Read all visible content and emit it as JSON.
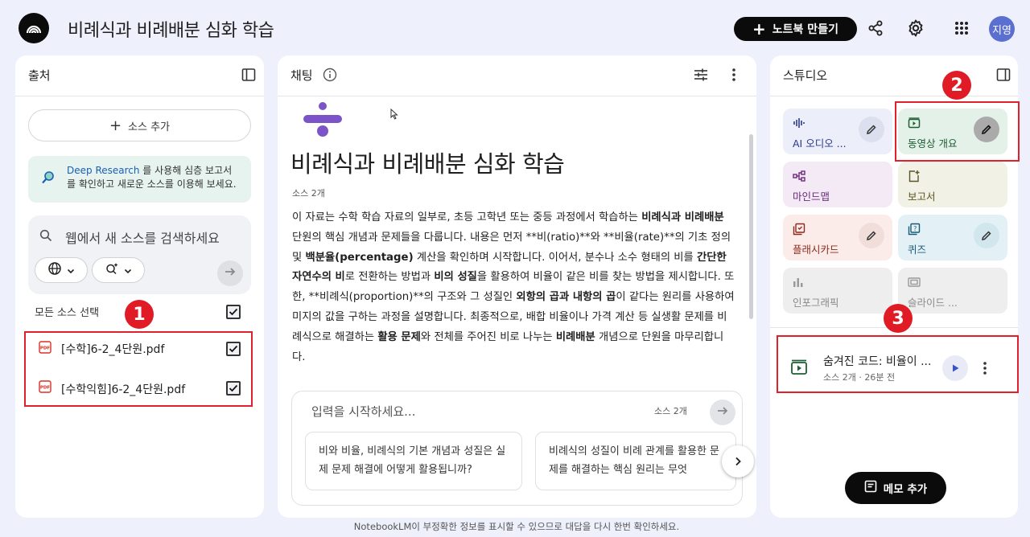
{
  "header": {
    "title": "비례식과 비례배분 심화 학습",
    "new_notebook_label": "노트북 만들기",
    "avatar_text": "지영",
    "icons": [
      "notebooklm-logo-icon",
      "share-icon",
      "gear-icon",
      "apps-grid-icon"
    ]
  },
  "sources_panel": {
    "title": "출처",
    "add_source_label": "소스 추가",
    "deep_research": {
      "link": "Deep Research",
      "text_1": " 를 사용해 심층 보고서",
      "text_2": "를 확인하고 새로운 소스를 이용해 보세요."
    },
    "web_search_placeholder": "웹에서 새 소스를 검색하세요",
    "select_all_label": "모든 소스 선택",
    "items": [
      {
        "name": "[수학]6-2_4단원.pdf",
        "checked": true
      },
      {
        "name": "[수학익힘]6-2_4단원.pdf",
        "checked": true
      }
    ]
  },
  "chat_panel": {
    "title": "채팅",
    "notebook_title": "비례식과 비례배분 심화 학습",
    "source_count": "소스 2개",
    "summary_parts": [
      {
        "t": "이 자료는 수학 학습 자료의 일부로, 초등 고학년 또는 중등 과정에서 학습하는 ",
        "b": false
      },
      {
        "t": "비례식과 비례배분",
        "b": true
      },
      {
        "t": " 단원의 핵심 개념과 문제들을 다룹니다. 내용은 먼저 **비(ratio)**와 **비율(rate)**의 기초 정의 및 ",
        "b": false
      },
      {
        "t": "백분율(percentage)",
        "b": true
      },
      {
        "t": " 계산을 확인하며 시작합니다. 이어서, 분수나 소수 형태의 비를 ",
        "b": false
      },
      {
        "t": "간단한 자연수의 비",
        "b": true
      },
      {
        "t": "로 전환하는 방법과 ",
        "b": false
      },
      {
        "t": "비의 성질",
        "b": true
      },
      {
        "t": "을 활용하여 비율이 같은 비를 찾는 방법을 제시합니다. 또한, **비례식(proportion)**의 구조와 그 성질인 ",
        "b": false
      },
      {
        "t": "외항의 곱과 내항의 곱",
        "b": true
      },
      {
        "t": "이 같다는 원리를 사용하여 미지의 값을 구하는 과정을 설명합니다. 최종적으로, 배합 비율이나 가격 계산 등 실생활 문제를 비례식으로 해결하는 ",
        "b": false
      },
      {
        "t": "활용 문제",
        "b": true
      },
      {
        "t": "와 전체를 주어진 비로 나누는 ",
        "b": false
      },
      {
        "t": "비례배분",
        "b": true
      },
      {
        "t": " 개념으로 단원을 마무리합니다.",
        "b": false
      }
    ],
    "input_placeholder": "입력을 시작하세요...",
    "input_source_count": "소스 2개",
    "suggestions": [
      "비와 비율, 비례식의 기본 개념과 성질은 실제 문제 해결에 어떻게 활용됩니까?",
      "비례식의 성질이 비례 관계를 활용한 문제를 해결하는 핵심 원리는 무엇"
    ]
  },
  "studio_panel": {
    "title": "스튜디오",
    "tiles": [
      {
        "label": "AI 오디오 ...",
        "icon": "audio-wave-icon",
        "color": "#eceef9",
        "text_color": "#2b3a8f"
      },
      {
        "label": "동영상 개요",
        "icon": "video-icon",
        "color": "#e3f1e8",
        "text_color": "#1d5e34"
      },
      {
        "label": "마인드맵",
        "icon": "mindmap-icon",
        "color": "#f3eaf5",
        "text_color": "#6b2a7c"
      },
      {
        "label": "보고서",
        "icon": "report-icon",
        "color": "#f2f1e6",
        "text_color": "#5b5420"
      },
      {
        "label": "플래시카드",
        "icon": "flashcard-icon",
        "color": "#fbecea",
        "text_color": "#8a2a1e"
      },
      {
        "label": "퀴즈",
        "icon": "quiz-icon",
        "color": "#e3f1f7",
        "text_color": "#1a5a74"
      },
      {
        "label": "인포그래픽",
        "icon": "infographic-icon",
        "color": "#eeeeee",
        "text_color": "#8a8a8a"
      },
      {
        "label": "슬라이드 ...",
        "icon": "slides-icon",
        "color": "#eeeeee",
        "text_color": "#8a8a8a"
      }
    ],
    "generated_item": {
      "title": "숨겨진 코드: 비율이 ...",
      "meta": "소스 2개 · 26분 전"
    },
    "add_memo_label": "메모 추가"
  },
  "annotations": {
    "badge_1": "1",
    "badge_2": "2",
    "badge_3": "3"
  },
  "footer": "NotebookLM이 부정확한 정보를 표시할 수 있으므로 대답을 다시 한번 확인하세요."
}
